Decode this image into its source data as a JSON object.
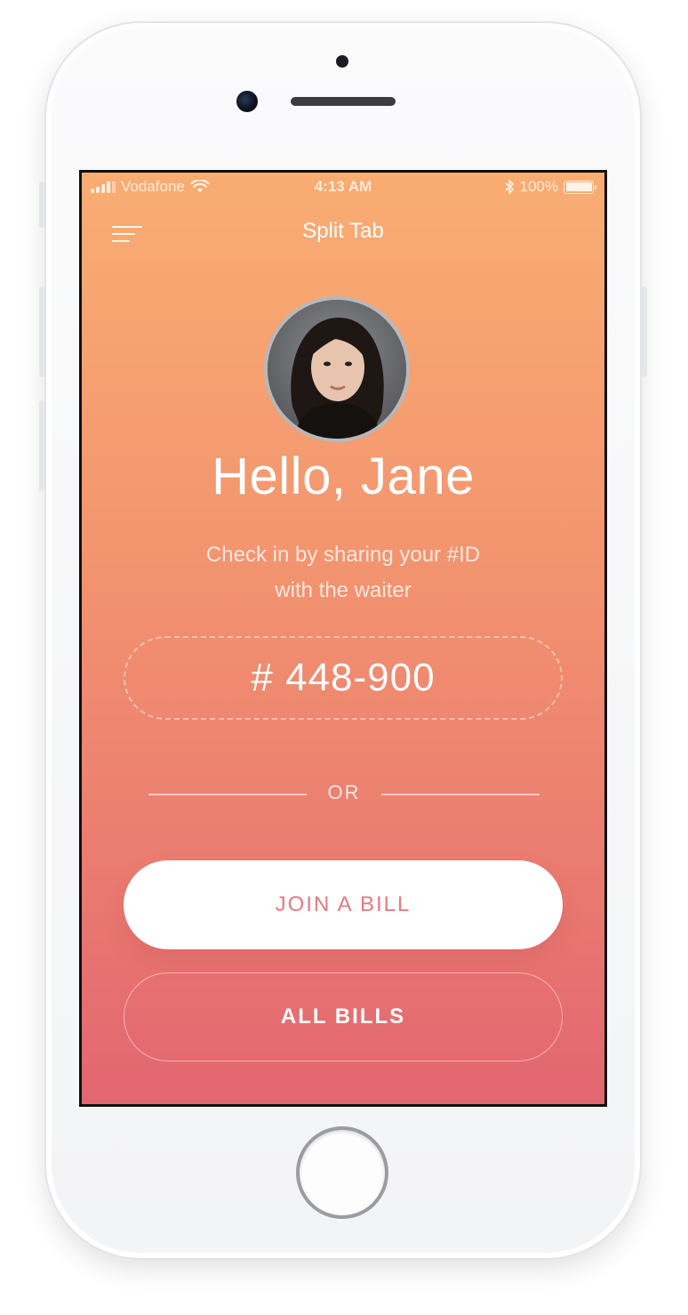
{
  "status_bar": {
    "carrier": "Vodafone",
    "time": "4:13 AM",
    "battery": "100%",
    "battery_level": 1.0,
    "icons": [
      "signal-bars-icon",
      "wifi-icon",
      "bluetooth-icon",
      "battery-icon"
    ]
  },
  "nav": {
    "title": "Split Tab",
    "menu_icon": "menu-icon"
  },
  "profile": {
    "greeting": "Hello, Jane",
    "avatar_icon": "user-avatar",
    "subtitle_line1": "Check in by sharing your #ID",
    "subtitle_line2": "with the waiter"
  },
  "checkin": {
    "id": "# 448-900"
  },
  "divider": {
    "label": "OR"
  },
  "actions": {
    "join_bill": "JOIN A BILL",
    "all_bills": "ALL BILLS"
  },
  "colors": {
    "gradient_top": "#f9ad72",
    "gradient_bottom": "#e26670",
    "primary_button_text": "#e57a82"
  }
}
